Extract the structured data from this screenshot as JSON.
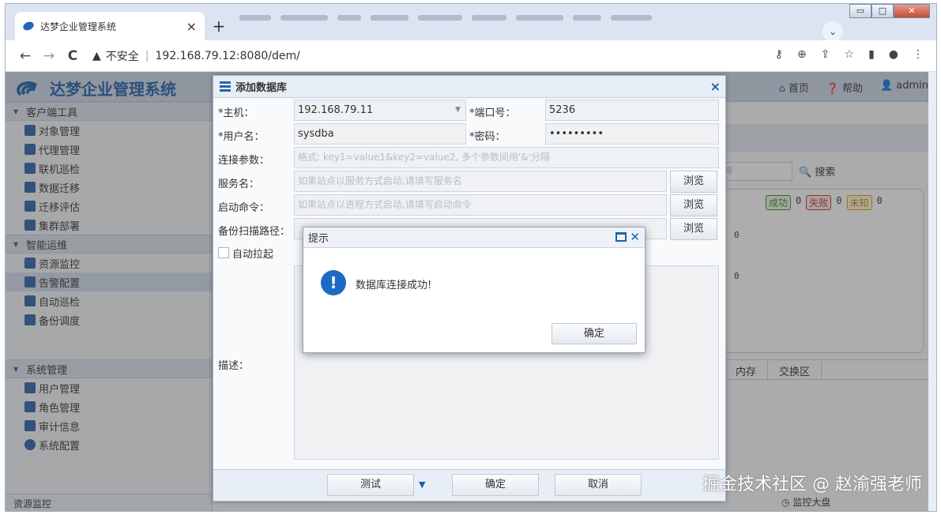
{
  "browser": {
    "tab_title": "达梦企业管理系统",
    "tab_close": "×",
    "new_tab": "+",
    "url_security": "不安全",
    "url": "192.168.79.12:8080/dem/",
    "nav": {
      "back": "←",
      "forward": "→",
      "reload": "C"
    },
    "window_controls": {
      "minimize": "▭",
      "maximize": "□",
      "close": "✕"
    },
    "tab_dropdown": "⌄",
    "tools": {
      "key": "⚷",
      "zoom": "⊕",
      "share": "⇪",
      "star": "☆",
      "sidepanel": "▮",
      "profile": "●",
      "menu": "⋮"
    }
  },
  "app": {
    "title": "达梦企业管理系统",
    "header_links": {
      "home": "首页",
      "help": "帮助",
      "user": "admin"
    }
  },
  "sidebar": {
    "sections": [
      {
        "title": "客户端工具",
        "items": [
          "对象管理",
          "代理管理",
          "联机巡检",
          "数据迁移",
          "迁移评估",
          "集群部署"
        ]
      },
      {
        "title": "智能运维",
        "items": [
          "资源监控",
          "告警配置",
          "自动巡检",
          "备份调度"
        ]
      },
      {
        "title": "系统管理",
        "items": [
          "用户管理",
          "角色管理",
          "审计信息",
          "系统配置"
        ]
      }
    ],
    "footer": "资源监控"
  },
  "main": {
    "search_placeholder": "称",
    "search_button": "搜索",
    "stats": {
      "success_label": "成功",
      "success_count": "0",
      "fail_label": "失败",
      "fail_count": "0",
      "unknown_label": "未知",
      "unknown_count": "0"
    },
    "zero_a": "0",
    "zero_b": "0",
    "columns": [
      "内存",
      "交换区"
    ],
    "monitor_big": "监控大盘"
  },
  "dialog": {
    "title": "添加数据库",
    "close": "×",
    "host_label": "*主机：",
    "host_value": "192.168.79.11",
    "port_label": "*端口号：",
    "port_value": "5236",
    "user_label": "*用户名：",
    "user_value": "sysdba",
    "pwd_label": "*密码：",
    "pwd_value": "•••••••••",
    "conn_label": "连接参数：",
    "conn_placeholder": "格式: key1=value1&key2=value2, 多个参数间用'&'分隔",
    "service_label": "服务名：",
    "service_placeholder": "如果站点以服务方式启动,请填写服务名",
    "start_label": "启动命令：",
    "start_placeholder": "如果站点以进程方式启动,请填写启动命令",
    "backup_label": "备份扫描路径：",
    "browse": "浏览",
    "auto_label": "自动拉起",
    "desc_label": "描述：",
    "test_button": "测试",
    "ok_button": "确定",
    "cancel_button": "取消"
  },
  "alert": {
    "title": "提示",
    "message": "数据库连接成功!",
    "ok": "确定",
    "icon": "!"
  },
  "watermark": "掘金技术社区 @ 赵渝强老师"
}
